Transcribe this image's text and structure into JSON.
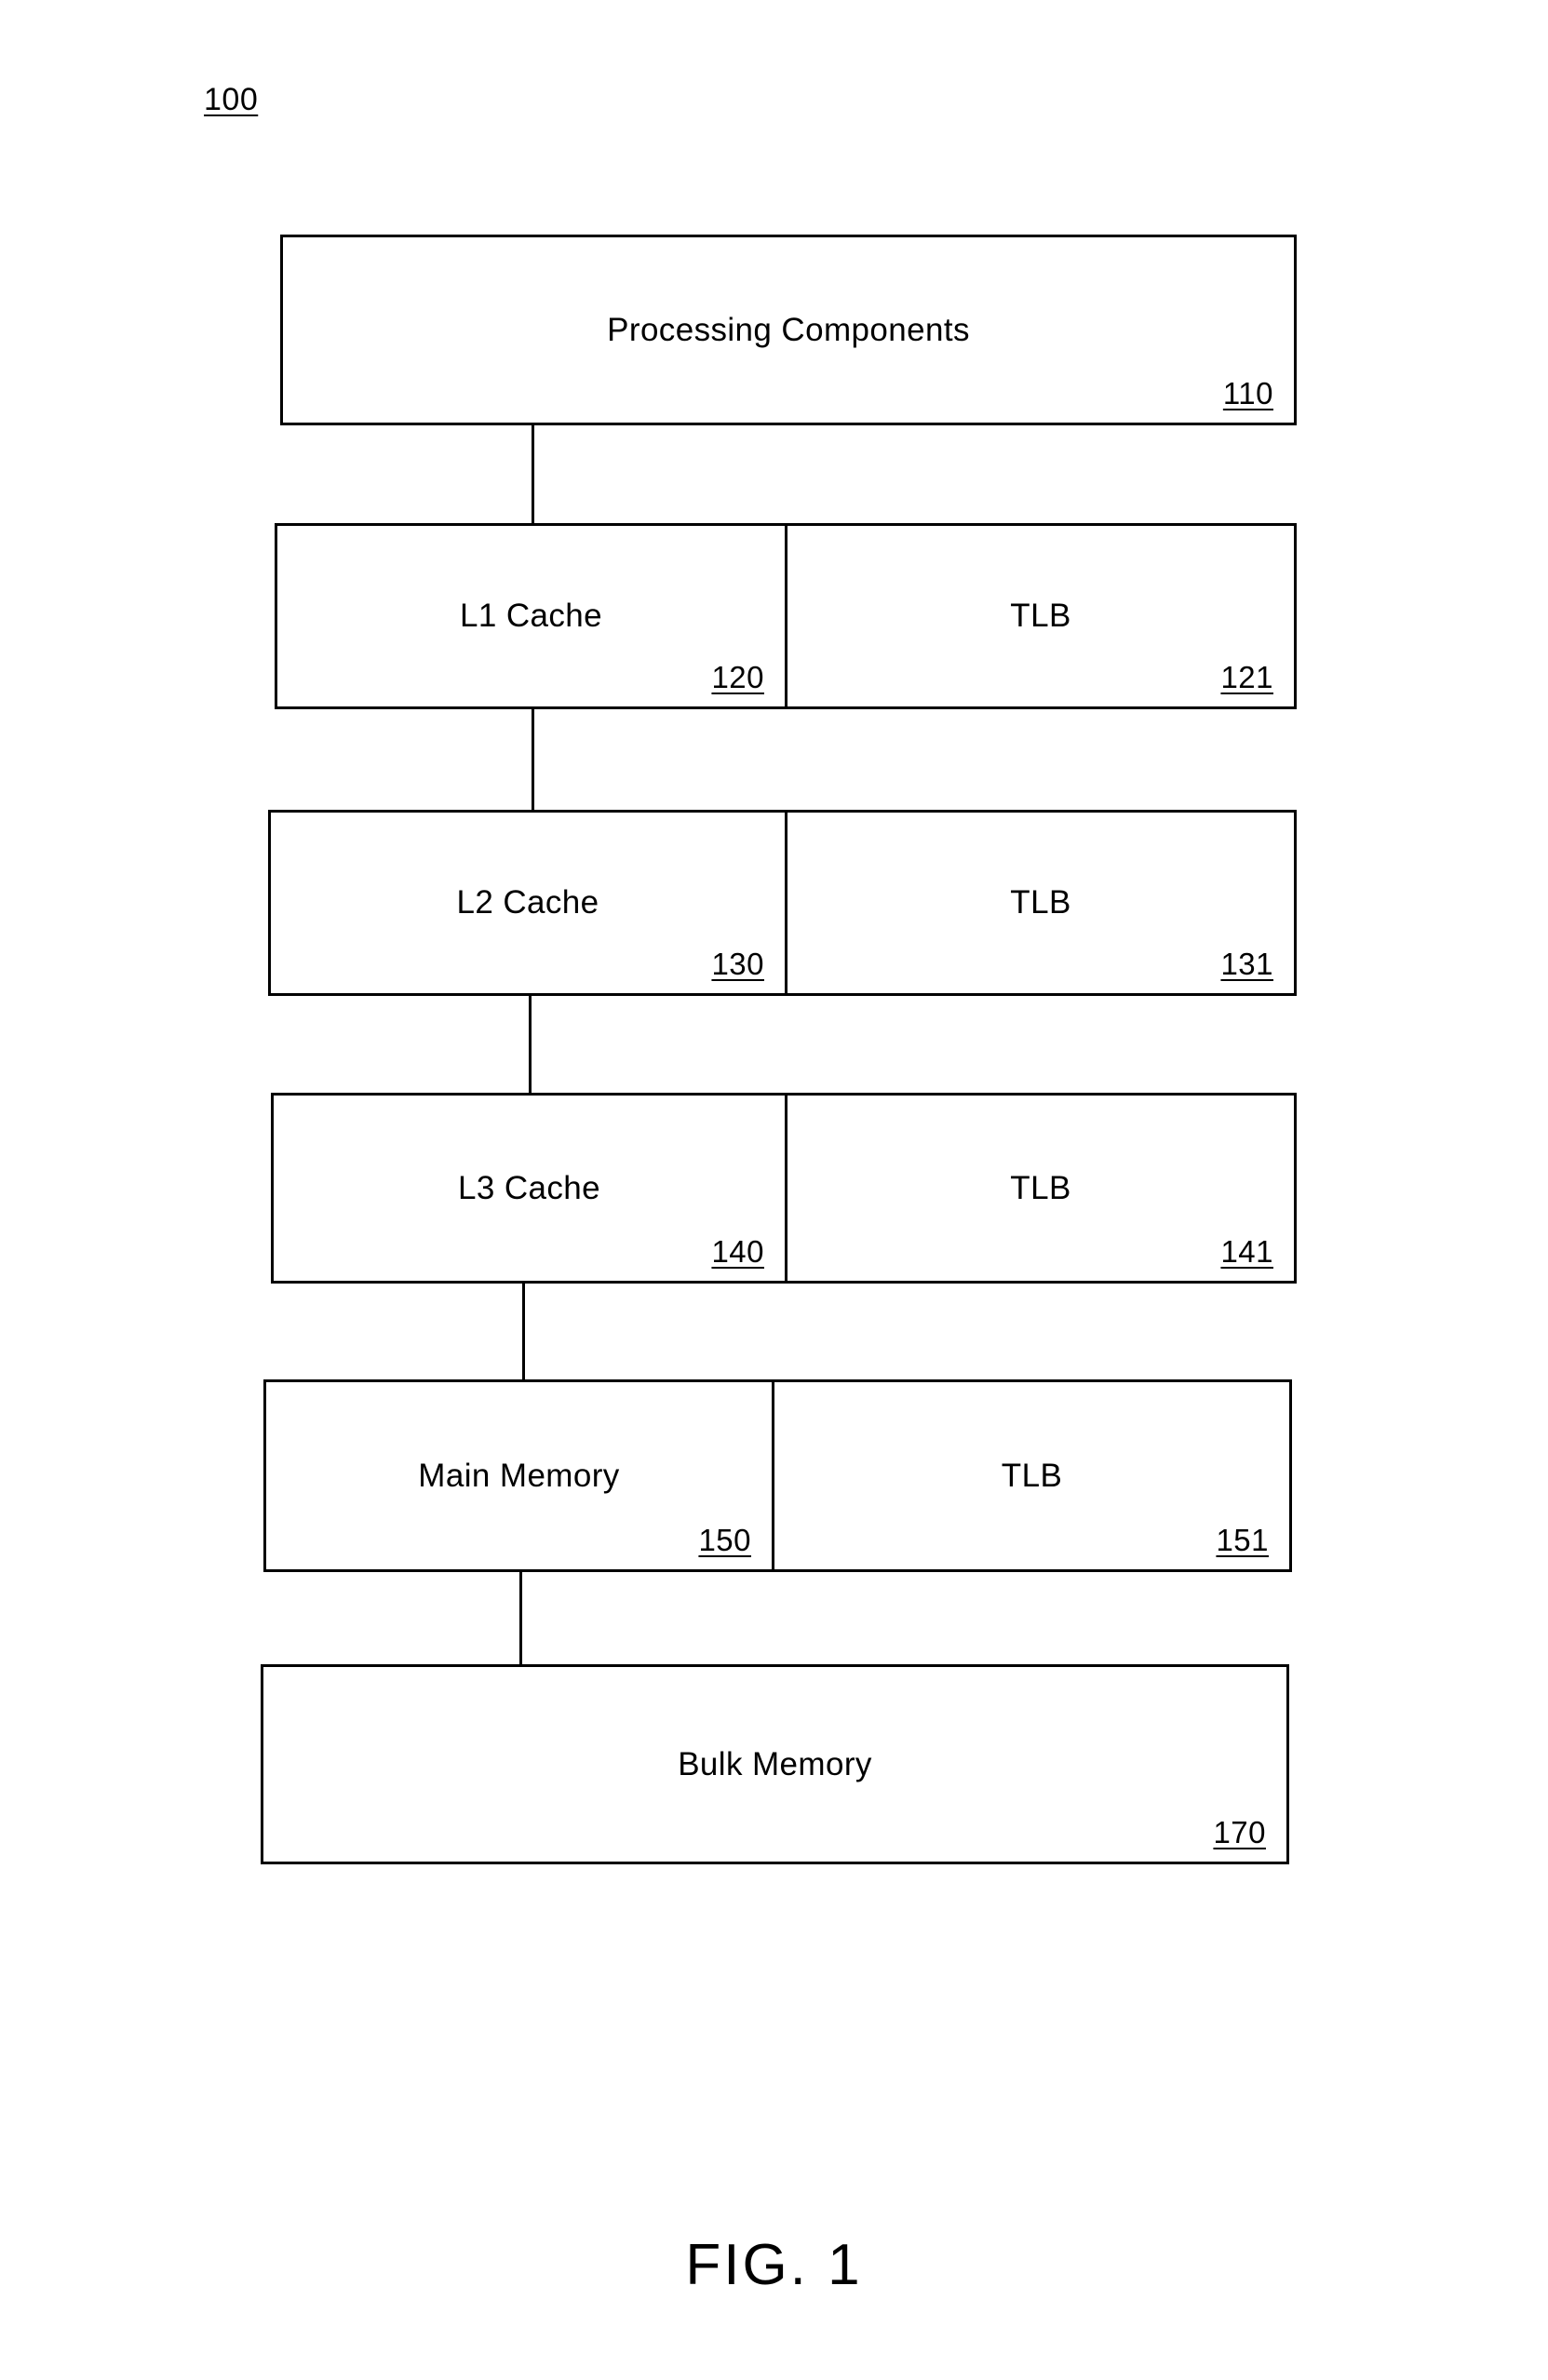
{
  "figure": {
    "reference_numeral": "100",
    "caption": "FIG. 1"
  },
  "blocks": [
    {
      "id": "processing-components",
      "left_label": "Processing Components",
      "left_number": "110",
      "split": false
    },
    {
      "id": "l1-cache",
      "left_label": "L1 Cache",
      "left_number": "120",
      "split": true,
      "right_label": "TLB",
      "right_number": "121"
    },
    {
      "id": "l2-cache",
      "left_label": "L2 Cache",
      "left_number": "130",
      "split": true,
      "right_label": "TLB",
      "right_number": "131"
    },
    {
      "id": "l3-cache",
      "left_label": "L3 Cache",
      "left_number": "140",
      "split": true,
      "right_label": "TLB",
      "right_number": "141"
    },
    {
      "id": "main-memory",
      "left_label": "Main Memory",
      "left_number": "150",
      "split": true,
      "right_label": "TLB",
      "right_number": "151"
    },
    {
      "id": "bulk-memory",
      "left_label": "Bulk Memory",
      "left_number": "170",
      "split": false
    }
  ],
  "colors": {
    "line": "#000000",
    "background": "#ffffff"
  }
}
